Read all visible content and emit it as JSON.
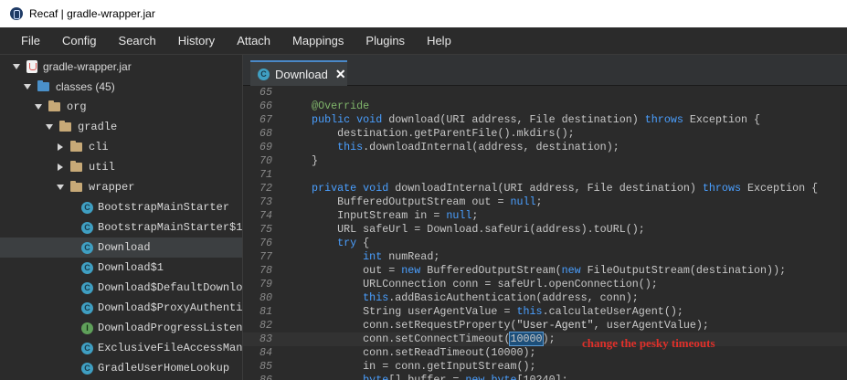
{
  "window": {
    "title": "Recaf | gradle-wrapper.jar"
  },
  "menu": [
    "File",
    "Config",
    "Search",
    "History",
    "Attach",
    "Mappings",
    "Plugins",
    "Help"
  ],
  "tree": [
    {
      "label": "gradle-wrapper.jar",
      "kind": "jar",
      "indent": 0,
      "arrow": "down"
    },
    {
      "label": "classes (45)",
      "kind": "folder-blue",
      "indent": 1,
      "arrow": "down"
    },
    {
      "label": "org",
      "kind": "folder",
      "indent": 2,
      "arrow": "down"
    },
    {
      "label": "gradle",
      "kind": "folder",
      "indent": 3,
      "arrow": "down"
    },
    {
      "label": "cli",
      "kind": "folder",
      "indent": 4,
      "arrow": "right"
    },
    {
      "label": "util",
      "kind": "folder",
      "indent": 4,
      "arrow": "right"
    },
    {
      "label": "wrapper",
      "kind": "folder",
      "indent": 4,
      "arrow": "down"
    },
    {
      "label": "BootstrapMainStarter",
      "kind": "class",
      "indent": 5,
      "arrow": ""
    },
    {
      "label": "BootstrapMainStarter$1",
      "kind": "class",
      "indent": 5,
      "arrow": ""
    },
    {
      "label": "Download",
      "kind": "class",
      "indent": 5,
      "arrow": "",
      "selected": true
    },
    {
      "label": "Download$1",
      "kind": "class",
      "indent": 5,
      "arrow": ""
    },
    {
      "label": "Download$DefaultDownloader",
      "kind": "class",
      "indent": 5,
      "arrow": ""
    },
    {
      "label": "Download$ProxyAuthenticator",
      "kind": "class",
      "indent": 5,
      "arrow": ""
    },
    {
      "label": "DownloadProgressListener",
      "kind": "interface",
      "indent": 5,
      "arrow": ""
    },
    {
      "label": "ExclusiveFileAccessManager",
      "kind": "class",
      "indent": 5,
      "arrow": ""
    },
    {
      "label": "GradleUserHomeLookup",
      "kind": "class",
      "indent": 5,
      "arrow": ""
    }
  ],
  "tab": {
    "label": "Download",
    "close": "✕"
  },
  "class_icon_letter": "C",
  "interface_icon_letter": "I",
  "code": {
    "current_line": 83,
    "lines": [
      {
        "n": "65",
        "parts": []
      },
      {
        "n": "66",
        "parts": [
          [
            "ann",
            "    @Override"
          ]
        ]
      },
      {
        "n": "67",
        "parts": [
          [
            "kw",
            "    public void"
          ],
          [
            "",
            " download(URI address, File destination) "
          ],
          [
            "kw",
            "throws"
          ],
          [
            "",
            " Exception {"
          ]
        ]
      },
      {
        "n": "68",
        "parts": [
          [
            "",
            "        destination.getParentFile().mkdirs();"
          ]
        ]
      },
      {
        "n": "69",
        "parts": [
          [
            "kw",
            "        this"
          ],
          [
            "",
            ".downloadInternal(address, destination);"
          ]
        ]
      },
      {
        "n": "70",
        "parts": [
          [
            "",
            "    }"
          ]
        ]
      },
      {
        "n": "71",
        "parts": []
      },
      {
        "n": "72",
        "parts": [
          [
            "kw",
            "    private void"
          ],
          [
            "",
            " downloadInternal(URI address, File destination) "
          ],
          [
            "kw",
            "throws"
          ],
          [
            "",
            " Exception {"
          ]
        ]
      },
      {
        "n": "73",
        "parts": [
          [
            "",
            "        BufferedOutputStream out = "
          ],
          [
            "kw",
            "null"
          ],
          [
            "",
            ";"
          ]
        ]
      },
      {
        "n": "74",
        "parts": [
          [
            "",
            "        InputStream in = "
          ],
          [
            "kw",
            "null"
          ],
          [
            "",
            ";"
          ]
        ]
      },
      {
        "n": "75",
        "parts": [
          [
            "",
            "        URL safeUrl = Download.safeUri(address).toURL();"
          ]
        ]
      },
      {
        "n": "76",
        "parts": [
          [
            "kw",
            "        try"
          ],
          [
            "",
            " {"
          ]
        ]
      },
      {
        "n": "77",
        "parts": [
          [
            "kw",
            "            int"
          ],
          [
            "",
            " numRead;"
          ]
        ]
      },
      {
        "n": "78",
        "parts": [
          [
            "",
            "            out = "
          ],
          [
            "kw",
            "new"
          ],
          [
            "",
            " BufferedOutputStream("
          ],
          [
            "kw",
            "new"
          ],
          [
            "",
            " FileOutputStream(destination));"
          ]
        ]
      },
      {
        "n": "79",
        "parts": [
          [
            "",
            "            URLConnection conn = safeUrl.openConnection();"
          ]
        ]
      },
      {
        "n": "80",
        "parts": [
          [
            "kw",
            "            this"
          ],
          [
            "",
            ".addBasicAuthentication(address, conn);"
          ]
        ]
      },
      {
        "n": "81",
        "parts": [
          [
            "",
            "            String userAgentValue = "
          ],
          [
            "kw",
            "this"
          ],
          [
            "",
            ".calculateUserAgent();"
          ]
        ]
      },
      {
        "n": "82",
        "parts": [
          [
            "",
            "            conn.setRequestProperty("
          ],
          [
            "str",
            "\"User-Agent\""
          ],
          [
            "",
            ", userAgentValue);"
          ]
        ]
      },
      {
        "n": "83",
        "parts": [
          [
            "",
            "            conn.setConnectTimeout("
          ],
          [
            "hl",
            "10000"
          ],
          [
            "",
            ");"
          ]
        ]
      },
      {
        "n": "84",
        "parts": [
          [
            "",
            "            conn.setReadTimeout(10000);"
          ]
        ]
      },
      {
        "n": "85",
        "parts": [
          [
            "",
            "            in = conn.getInputStream();"
          ]
        ]
      },
      {
        "n": "86",
        "parts": [
          [
            "kw",
            "            byte"
          ],
          [
            "",
            "[] buffer = "
          ],
          [
            "kw",
            "new byte"
          ],
          [
            "",
            "[10240];"
          ]
        ]
      }
    ]
  },
  "annotation_note": "change the pesky timeouts"
}
